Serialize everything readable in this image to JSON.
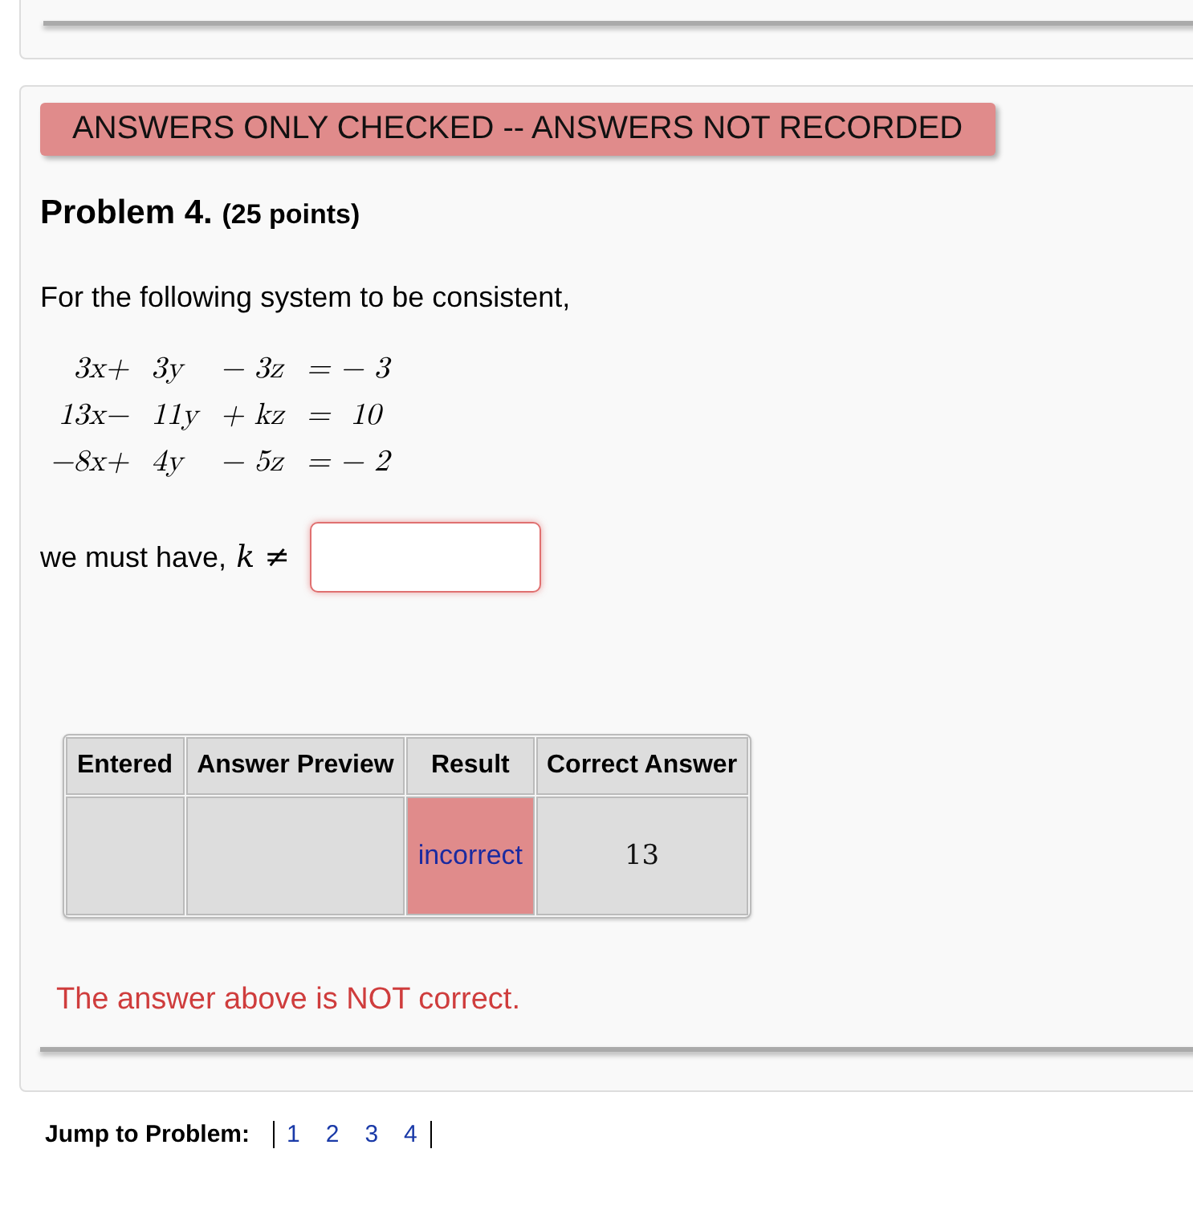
{
  "banner": "ANSWERS ONLY CHECKED -- ANSWERS NOT RECORDED",
  "problem": {
    "title": "Problem 4.",
    "points": "(25 points)",
    "prompt": "For the following system to be consistent,",
    "equations": [
      [
        "3x+",
        "3y",
        "− 3z",
        "= − 3"
      ],
      [
        "13x−",
        "11y",
        "+ kz",
        "=  10"
      ],
      [
        "−8x+",
        "4y",
        "− 5z",
        "= − 2"
      ]
    ],
    "answer_label": "we must have, ",
    "answer_symbol": "*k* ≠",
    "answer": {
      "invalid": true
    }
  },
  "results": {
    "columns": [
      "Entered",
      "Answer Preview",
      "Result",
      "Correct Answer"
    ],
    "rows": [
      {
        "result": "incorrect",
        "correct": false,
        "correct_answer": "13"
      }
    ]
  },
  "message": "The answer above is NOT correct.",
  "jump": {
    "label": "Jump to Problem:",
    "links": [
      "1",
      "2",
      "3",
      "4"
    ]
  }
}
